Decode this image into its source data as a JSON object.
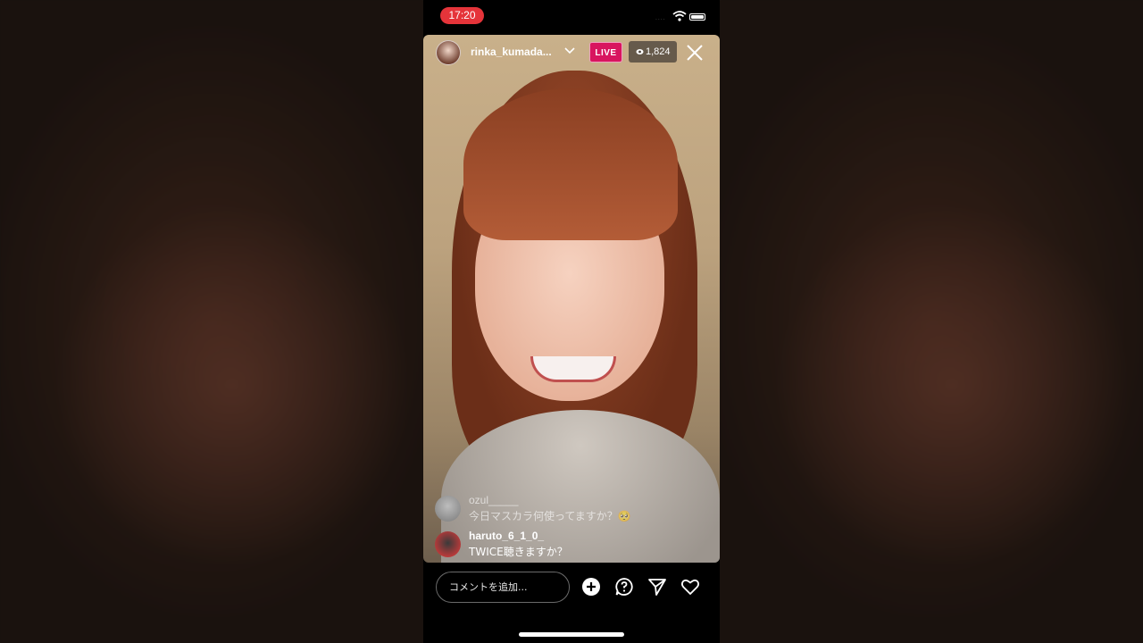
{
  "status_bar": {
    "time": "17:20",
    "signal_text": "....",
    "icons": [
      "wifi-icon",
      "battery-icon"
    ]
  },
  "live": {
    "username": "rinka_kumada...",
    "badge": "LIVE",
    "viewer_count": "1,824",
    "badge_color": "#d8155f"
  },
  "comments": [
    {
      "user": "ozul_____",
      "text": "今日マスカラ何使ってますか？🥺"
    },
    {
      "user": "haruto_6_1_0_",
      "text": "TWICE聴きますか？"
    }
  ],
  "composer": {
    "placeholder": "コメントを追加...",
    "actions": [
      "add-icon",
      "question-icon",
      "send-icon",
      "heart-icon"
    ]
  },
  "colors": {
    "time_pill": "#e5343a",
    "background": "#000000"
  }
}
